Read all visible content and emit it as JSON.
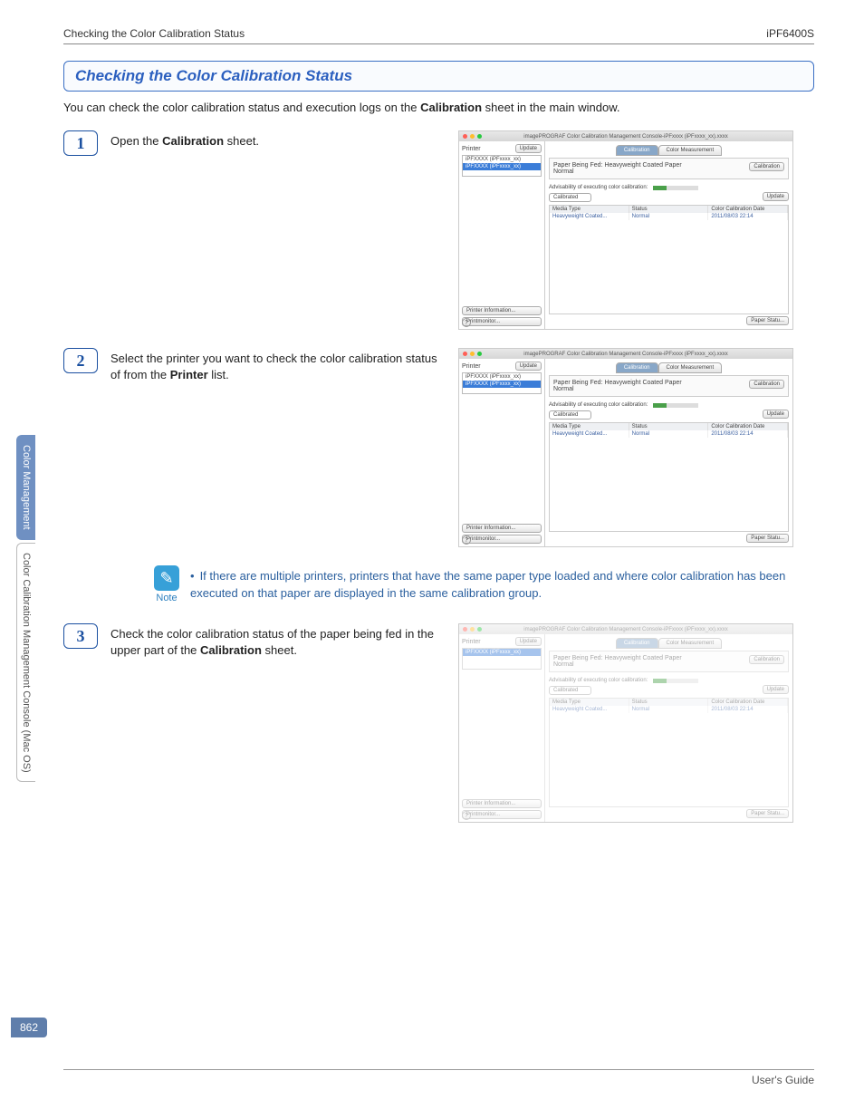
{
  "header": {
    "left": "Checking the Color Calibration Status",
    "right": "iPF6400S"
  },
  "title": "Checking the Color Calibration Status",
  "intro_pre": "You can check the color calibration status and execution logs on the ",
  "intro_bold": "Calibration",
  "intro_post": " sheet in the main window.",
  "steps": {
    "s1": {
      "num": "1",
      "text_pre": "Open the ",
      "text_bold": "Calibration",
      "text_post": " sheet."
    },
    "s2": {
      "num": "2",
      "text_pre": "Select the printer you want to check the color calibration status of from the ",
      "text_bold": "Printer",
      "text_post": " list."
    },
    "s3": {
      "num": "3",
      "text_pre": "Check the color calibration status of the paper being fed in the upper part of the ",
      "text_bold": "Calibration",
      "text_post": " sheet."
    }
  },
  "note": {
    "label": "Note",
    "bullet": "•",
    "text": "If there are multiple printers, printers that have the same paper type loaded and where color calibration has been executed on that paper are displayed in the same calibration group."
  },
  "screenshot": {
    "window_title": "imagePROGRAF Color Calibration Management Console-iPFxxxx (iPFxxxx_xx).xxxx",
    "printer_label": "Printer",
    "update_btn": "Update",
    "printers": [
      "iPFXXXX (iPFxxxx_xx)",
      "iPFXXXX (iPFxxxx_xx)"
    ],
    "printer_info_btn": "Printer Information...",
    "printmonitor_btn": "Printmonitor...",
    "help": "?",
    "tab_calibration": "Calibration",
    "tab_measurement": "Color Measurement",
    "paper_label": "Paper Being Fed:",
    "paper_value": "Heavyweight Coated Paper",
    "status_value": "Normal",
    "calibration_btn": "Calibration",
    "adv_label": "Advisability of executing color calibration:",
    "dropdown_value": "Calibrated",
    "col_media": "Media Type",
    "col_status": "Status",
    "col_date": "Color Calibration Date",
    "row_media": "Heavyweight Coated...",
    "row_status": "Normal",
    "row_date": "2011/08/03 22:14",
    "paper_status_btn": "Paper Statu..."
  },
  "side": {
    "tab1": "Color Management",
    "tab2": "Color Calibration Management Console (Mac OS)"
  },
  "page_number": "862",
  "footer": "User's Guide"
}
